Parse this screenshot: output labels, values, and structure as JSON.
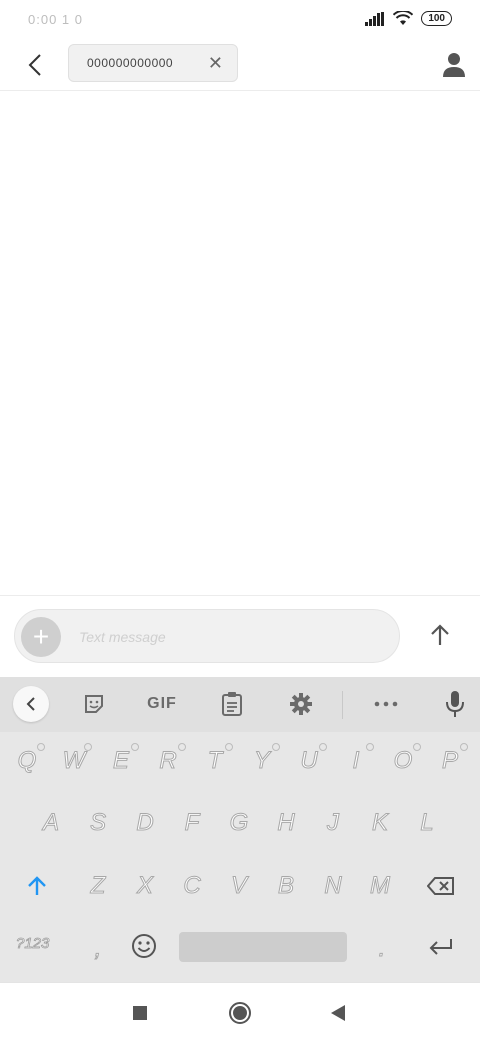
{
  "status_bar": {
    "time": "0:00 1 0",
    "battery": "100",
    "icons": [
      "signal-icon",
      "wifi-icon",
      "battery-icon"
    ]
  },
  "header": {
    "back_icon": "chevron-left-icon",
    "recipient": "000000000000",
    "clear_icon": "close-icon",
    "contact_icon": "person-icon"
  },
  "composer": {
    "placeholder": "Text message",
    "add_icon": "plus-icon",
    "send_icon": "arrow-up-icon"
  },
  "keyboard": {
    "toolbar": {
      "back_icon": "chevron-left-icon",
      "sticker_icon": "sticker-icon",
      "gif_label": "GIF",
      "clipboard_icon": "clipboard-icon",
      "settings_icon": "gear-icon",
      "more_icon": "more-icon",
      "mic_icon": "mic-icon"
    },
    "row1": [
      "Q",
      "W",
      "E",
      "R",
      "T",
      "Y",
      "U",
      "I",
      "O",
      "P"
    ],
    "row2": [
      "A",
      "S",
      "D",
      "F",
      "G",
      "H",
      "J",
      "K",
      "L"
    ],
    "row3": [
      "Z",
      "X",
      "C",
      "V",
      "B",
      "N",
      "M"
    ],
    "symbols_label": "?123",
    "comma": ",",
    "period": ".",
    "shift_icon": "shift-arrow-icon",
    "backspace_icon": "backspace-icon",
    "emoji_icon": "emoji-icon",
    "enter_icon": "enter-icon"
  },
  "nav_bar": {
    "recents_icon": "square-icon",
    "home_icon": "circle-icon",
    "back_icon": "triangle-back-icon"
  },
  "colors": {
    "accent": "#2196f3",
    "keyboard_bg": "#e7e7e7"
  }
}
